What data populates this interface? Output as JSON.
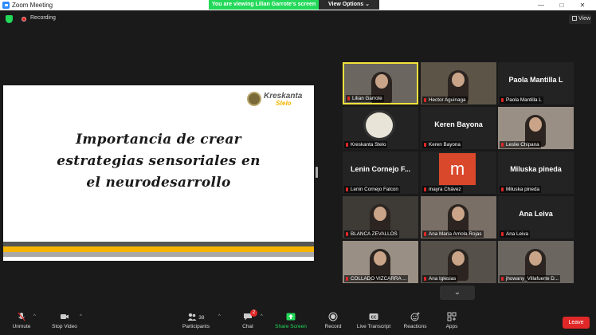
{
  "window": {
    "title": "Zoom Meeting",
    "controls": [
      "—",
      "□",
      "✕"
    ]
  },
  "banner": {
    "viewing": "You are viewing Lilian Garrote's screen",
    "view_options": "View Options ⌄"
  },
  "topbar": {
    "recording": "Recording",
    "view": "View"
  },
  "slide": {
    "logo_line1": "Kreskanta",
    "logo_line2": "Stelo",
    "headline": [
      "Importancia de crear",
      "estrategias sensoriales en",
      "el neurodesarrollo"
    ]
  },
  "participants": [
    {
      "label": "Lilian Garrote",
      "big": "",
      "kind": "video",
      "active": true
    },
    {
      "label": "Hector Aguinaga",
      "big": "",
      "kind": "video"
    },
    {
      "label": "Paola Mantilla L",
      "big": "Paola Mantilla L",
      "kind": "name"
    },
    {
      "label": "Kreskanta Stelo",
      "big": "",
      "kind": "logo"
    },
    {
      "label": "Keren Bayona",
      "big": "Keren Bayona",
      "kind": "name"
    },
    {
      "label": "Leslie Chipana",
      "big": "",
      "kind": "video"
    },
    {
      "label": "Lenin Cornejo Falcon",
      "big": "Lenin Cornejo F...",
      "kind": "name"
    },
    {
      "label": "mayra Chávez",
      "big": "m",
      "kind": "avatar"
    },
    {
      "label": "Miluska pineda",
      "big": "Miluska pineda",
      "kind": "name"
    },
    {
      "label": "BLANCA ZEVALLOS",
      "big": "",
      "kind": "video"
    },
    {
      "label": "Ana María Arriola Rojas",
      "big": "",
      "kind": "video"
    },
    {
      "label": "Ana Leiva",
      "big": "Ana Leiva",
      "kind": "name"
    },
    {
      "label": "COLLADO VIZCARRA ...",
      "big": "",
      "kind": "video"
    },
    {
      "label": "Ana Iglesias",
      "big": "",
      "kind": "video"
    },
    {
      "label": "jhowany_Villafuerte D...",
      "big": "",
      "kind": "video"
    }
  ],
  "scroll_down": "⌄",
  "toolbar": {
    "unmute": "Unmute",
    "stop_video": "Stop Video",
    "participants": "Participants",
    "participants_count": "38",
    "chat": "Chat",
    "chat_badge": "2",
    "share_screen": "Share Screen",
    "record": "Record",
    "live_transcript": "Live Transcript",
    "reactions": "Reactions",
    "apps": "Apps",
    "leave": "Leave",
    "caret": "^"
  },
  "colors": {
    "share_green": "#23d959",
    "leave_red": "#e02828",
    "active_speaker": "#f3e23a",
    "avatar_orange": "#d9482b"
  }
}
